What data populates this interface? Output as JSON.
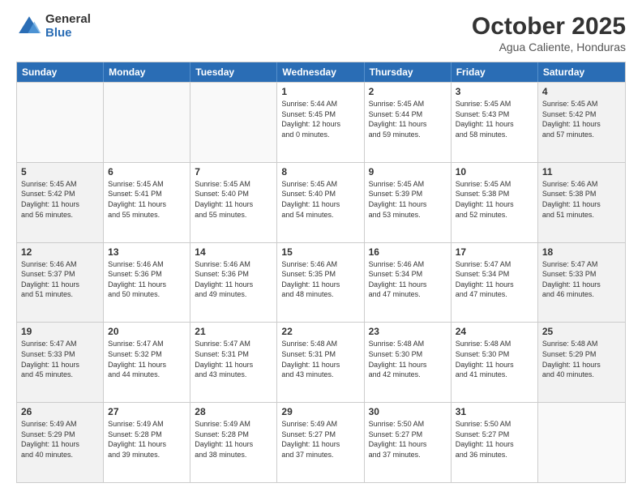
{
  "logo": {
    "general": "General",
    "blue": "Blue"
  },
  "header": {
    "month": "October 2025",
    "location": "Agua Caliente, Honduras"
  },
  "weekdays": [
    "Sunday",
    "Monday",
    "Tuesday",
    "Wednesday",
    "Thursday",
    "Friday",
    "Saturday"
  ],
  "weeks": [
    [
      {
        "day": "",
        "text": "",
        "empty": true
      },
      {
        "day": "",
        "text": "",
        "empty": true
      },
      {
        "day": "",
        "text": "",
        "empty": true
      },
      {
        "day": "1",
        "text": "Sunrise: 5:44 AM\nSunset: 5:45 PM\nDaylight: 12 hours\nand 0 minutes.",
        "empty": false
      },
      {
        "day": "2",
        "text": "Sunrise: 5:45 AM\nSunset: 5:44 PM\nDaylight: 11 hours\nand 59 minutes.",
        "empty": false
      },
      {
        "day": "3",
        "text": "Sunrise: 5:45 AM\nSunset: 5:43 PM\nDaylight: 11 hours\nand 58 minutes.",
        "empty": false
      },
      {
        "day": "4",
        "text": "Sunrise: 5:45 AM\nSunset: 5:42 PM\nDaylight: 11 hours\nand 57 minutes.",
        "empty": false,
        "shaded": true
      }
    ],
    [
      {
        "day": "5",
        "text": "Sunrise: 5:45 AM\nSunset: 5:42 PM\nDaylight: 11 hours\nand 56 minutes.",
        "shaded": true
      },
      {
        "day": "6",
        "text": "Sunrise: 5:45 AM\nSunset: 5:41 PM\nDaylight: 11 hours\nand 55 minutes."
      },
      {
        "day": "7",
        "text": "Sunrise: 5:45 AM\nSunset: 5:40 PM\nDaylight: 11 hours\nand 55 minutes."
      },
      {
        "day": "8",
        "text": "Sunrise: 5:45 AM\nSunset: 5:40 PM\nDaylight: 11 hours\nand 54 minutes."
      },
      {
        "day": "9",
        "text": "Sunrise: 5:45 AM\nSunset: 5:39 PM\nDaylight: 11 hours\nand 53 minutes."
      },
      {
        "day": "10",
        "text": "Sunrise: 5:45 AM\nSunset: 5:38 PM\nDaylight: 11 hours\nand 52 minutes."
      },
      {
        "day": "11",
        "text": "Sunrise: 5:46 AM\nSunset: 5:38 PM\nDaylight: 11 hours\nand 51 minutes.",
        "shaded": true
      }
    ],
    [
      {
        "day": "12",
        "text": "Sunrise: 5:46 AM\nSunset: 5:37 PM\nDaylight: 11 hours\nand 51 minutes.",
        "shaded": true
      },
      {
        "day": "13",
        "text": "Sunrise: 5:46 AM\nSunset: 5:36 PM\nDaylight: 11 hours\nand 50 minutes."
      },
      {
        "day": "14",
        "text": "Sunrise: 5:46 AM\nSunset: 5:36 PM\nDaylight: 11 hours\nand 49 minutes."
      },
      {
        "day": "15",
        "text": "Sunrise: 5:46 AM\nSunset: 5:35 PM\nDaylight: 11 hours\nand 48 minutes."
      },
      {
        "day": "16",
        "text": "Sunrise: 5:46 AM\nSunset: 5:34 PM\nDaylight: 11 hours\nand 47 minutes."
      },
      {
        "day": "17",
        "text": "Sunrise: 5:47 AM\nSunset: 5:34 PM\nDaylight: 11 hours\nand 47 minutes."
      },
      {
        "day": "18",
        "text": "Sunrise: 5:47 AM\nSunset: 5:33 PM\nDaylight: 11 hours\nand 46 minutes.",
        "shaded": true
      }
    ],
    [
      {
        "day": "19",
        "text": "Sunrise: 5:47 AM\nSunset: 5:33 PM\nDaylight: 11 hours\nand 45 minutes.",
        "shaded": true
      },
      {
        "day": "20",
        "text": "Sunrise: 5:47 AM\nSunset: 5:32 PM\nDaylight: 11 hours\nand 44 minutes."
      },
      {
        "day": "21",
        "text": "Sunrise: 5:47 AM\nSunset: 5:31 PM\nDaylight: 11 hours\nand 43 minutes."
      },
      {
        "day": "22",
        "text": "Sunrise: 5:48 AM\nSunset: 5:31 PM\nDaylight: 11 hours\nand 43 minutes."
      },
      {
        "day": "23",
        "text": "Sunrise: 5:48 AM\nSunset: 5:30 PM\nDaylight: 11 hours\nand 42 minutes."
      },
      {
        "day": "24",
        "text": "Sunrise: 5:48 AM\nSunset: 5:30 PM\nDaylight: 11 hours\nand 41 minutes."
      },
      {
        "day": "25",
        "text": "Sunrise: 5:48 AM\nSunset: 5:29 PM\nDaylight: 11 hours\nand 40 minutes.",
        "shaded": true
      }
    ],
    [
      {
        "day": "26",
        "text": "Sunrise: 5:49 AM\nSunset: 5:29 PM\nDaylight: 11 hours\nand 40 minutes.",
        "shaded": true
      },
      {
        "day": "27",
        "text": "Sunrise: 5:49 AM\nSunset: 5:28 PM\nDaylight: 11 hours\nand 39 minutes."
      },
      {
        "day": "28",
        "text": "Sunrise: 5:49 AM\nSunset: 5:28 PM\nDaylight: 11 hours\nand 38 minutes."
      },
      {
        "day": "29",
        "text": "Sunrise: 5:49 AM\nSunset: 5:27 PM\nDaylight: 11 hours\nand 37 minutes."
      },
      {
        "day": "30",
        "text": "Sunrise: 5:50 AM\nSunset: 5:27 PM\nDaylight: 11 hours\nand 37 minutes."
      },
      {
        "day": "31",
        "text": "Sunrise: 5:50 AM\nSunset: 5:27 PM\nDaylight: 11 hours\nand 36 minutes."
      },
      {
        "day": "",
        "text": "",
        "empty": true,
        "shaded": true
      }
    ]
  ]
}
